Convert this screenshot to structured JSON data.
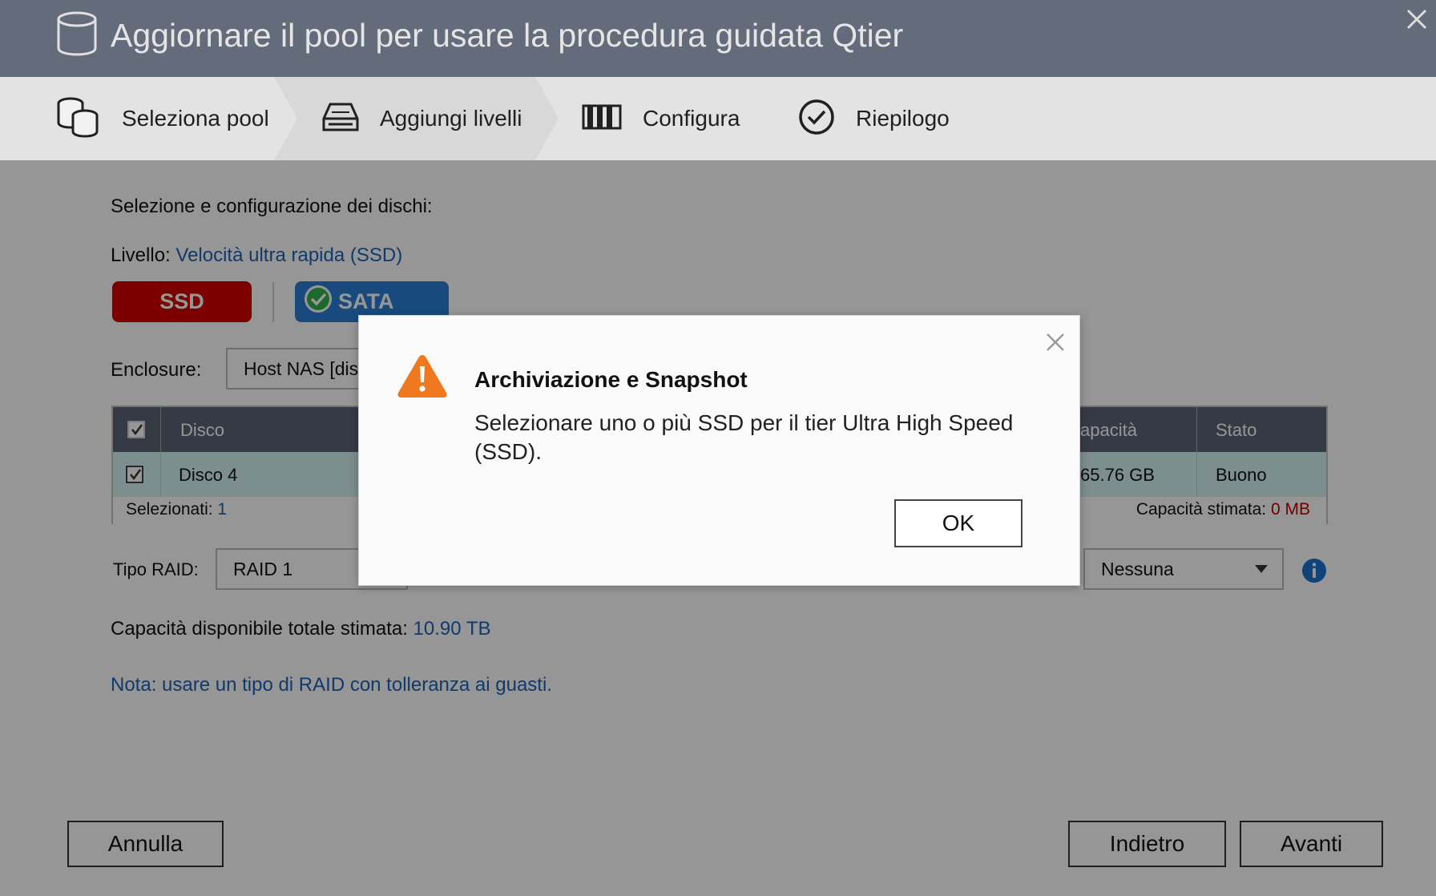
{
  "window": {
    "title": "Aggiornare il pool per usare la procedura guidata Qtier"
  },
  "steps": [
    {
      "label": "Seleziona pool",
      "icon": "disk-stack-icon"
    },
    {
      "label": "Aggiungi livelli",
      "icon": "drive-icon"
    },
    {
      "label": "Configura",
      "icon": "config-bars-icon"
    },
    {
      "label": "Riepilogo",
      "icon": "check-circle-icon"
    }
  ],
  "main": {
    "heading": "Selezione e configurazione dei dischi:",
    "level_label": "Livello:",
    "level_value": "Velocità ultra rapida (SSD)",
    "type_buttons": {
      "ssd": "SSD",
      "sata": "SATA"
    },
    "enclosure_label": "Enclosure:",
    "enclosure_value": "Host NAS [dis",
    "table": {
      "headers": {
        "disk": "Disco",
        "capacity": "apacità",
        "status": "Stato"
      },
      "rows": [
        {
          "disk": "Disco 4",
          "capacity": "65.76 GB",
          "status": "Buono"
        }
      ],
      "selected_label": "Selezionati:",
      "selected_count": "1",
      "estimated_label": "Capacità stimata:",
      "estimated_value": "0 MB"
    },
    "raid_label": "Tipo RAID:",
    "raid_value": "RAID 1",
    "second_select_value": "Nessuna",
    "total_label": "Capacità disponibile totale stimata:",
    "total_value": "10.90 TB",
    "note": "Nota: usare un tipo di RAID con tolleranza ai guasti."
  },
  "footer": {
    "cancel": "Annulla",
    "back": "Indietro",
    "next": "Avanti"
  },
  "dialog": {
    "title": "Archiviazione e Snapshot",
    "message": "Selezionare uno o più SSD per il tier Ultra High Speed (SSD).",
    "ok": "OK"
  },
  "colors": {
    "accent_blue": "#1c63b7",
    "ssd_red": "#d40000",
    "sata_blue": "#2a7fd4",
    "warning_orange": "#f0781e"
  }
}
